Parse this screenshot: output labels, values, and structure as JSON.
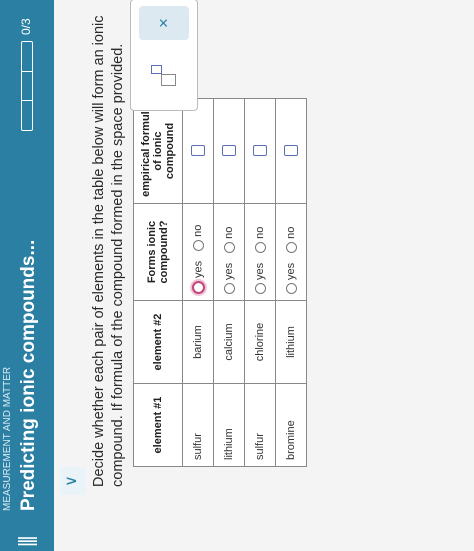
{
  "header": {
    "category": "MEASUREMENT AND MATTER",
    "title": "Predicting ionic compounds...",
    "score": "0/3",
    "progress": 0
  },
  "instructions": "Decide whether each pair of elements in the table below will form an ionic compound. If formula of the compound formed in the space provided.",
  "table": {
    "headers": [
      "element #1",
      "element #2",
      "Forms ionic compound?",
      "empirical formula of ionic compound"
    ],
    "option_yes": "yes",
    "option_no": "no",
    "rows": [
      {
        "element1": "sulfur",
        "element2": "barium",
        "selected": "yes"
      },
      {
        "element1": "lithium",
        "element2": "calcium",
        "selected": "none"
      },
      {
        "element1": "sulfur",
        "element2": "chlorine",
        "selected": "none"
      },
      {
        "element1": "bromine",
        "element2": "lithium",
        "selected": "none"
      }
    ]
  },
  "tools": {
    "close_symbol": "×"
  },
  "icons": {
    "menu": "hamburger-icon",
    "expand": "chevron-down-icon",
    "close": "close-icon"
  },
  "colors": {
    "accent": "#2b7fa3",
    "selected_radio": "#c2467e",
    "formula_box": "#5a6fb8"
  }
}
